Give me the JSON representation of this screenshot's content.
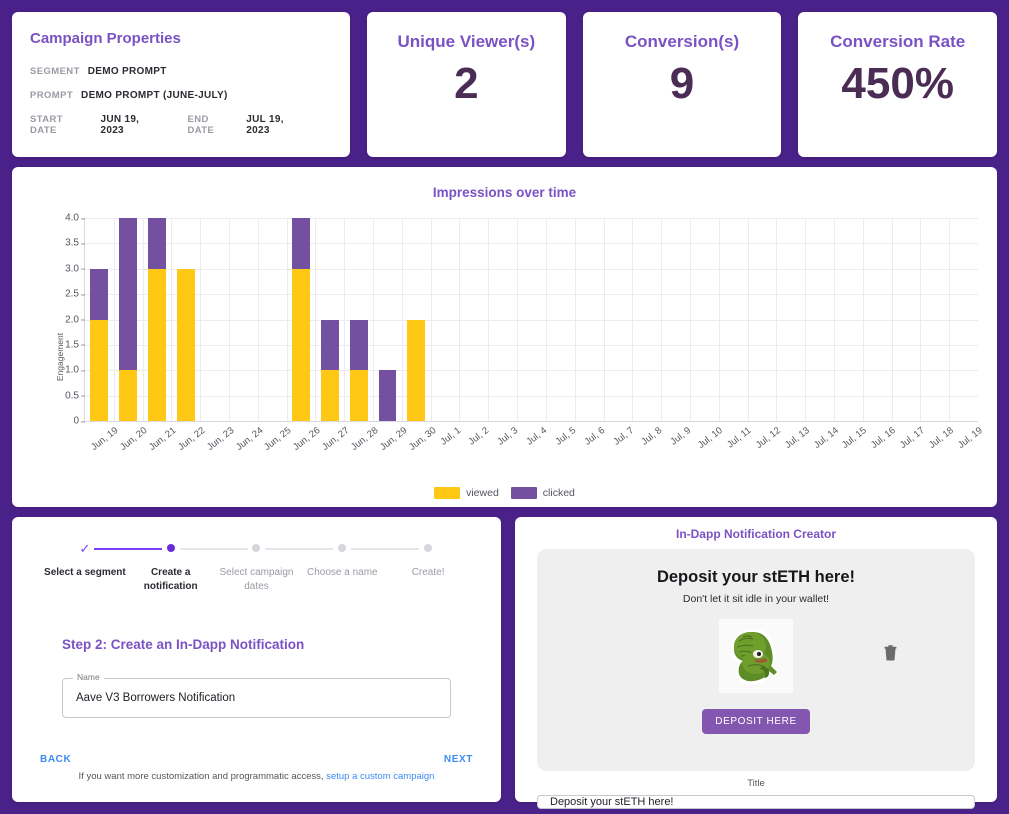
{
  "campaign": {
    "title": "Campaign Properties",
    "rows": [
      {
        "label": "SEGMENT",
        "value": "DEMO PROMPT"
      },
      {
        "label": "PROMPT",
        "value": "DEMO PROMPT (JUNE-JULY)"
      }
    ],
    "start_label": "START DATE",
    "start_value": "JUN 19, 2023",
    "end_label": "END DATE",
    "end_value": "JUL 19, 2023"
  },
  "stats": [
    {
      "label": "Unique Viewer(s)",
      "value": "2"
    },
    {
      "label": "Conversion(s)",
      "value": "9"
    },
    {
      "label": "Conversion Rate",
      "value": "450%"
    }
  ],
  "chart_data": {
    "type": "bar",
    "title": "Impressions over time",
    "xlabel": "",
    "ylabel": "Engagement",
    "ylim": [
      0,
      4.0
    ],
    "yticks": [
      0,
      0.5,
      1.0,
      1.5,
      2.0,
      2.5,
      3.0,
      3.5,
      4.0
    ],
    "ytick_labels": [
      "0",
      "0.5",
      "1.0",
      "1.5",
      "2.0",
      "2.5",
      "3.0",
      "3.5",
      "4.0"
    ],
    "stacked": true,
    "grid": true,
    "legend_position": "bottom",
    "categories": [
      "Jun, 19",
      "Jun, 20",
      "Jun, 21",
      "Jun, 22",
      "Jun, 23",
      "Jun, 24",
      "Jun, 25",
      "Jun, 26",
      "Jun, 27",
      "Jun, 28",
      "Jun, 29",
      "Jun, 30",
      "Jul, 1",
      "Jul, 2",
      "Jul, 3",
      "Jul, 4",
      "Jul, 5",
      "Jul, 6",
      "Jul, 7",
      "Jul, 8",
      "Jul, 9",
      "Jul, 10",
      "Jul, 11",
      "Jul, 12",
      "Jul, 13",
      "Jul, 14",
      "Jul, 15",
      "Jul, 16",
      "Jul, 17",
      "Jul, 18",
      "Jul, 19"
    ],
    "series": [
      {
        "name": "viewed",
        "color": "#FFC814",
        "values": [
          2,
          1,
          3,
          3,
          0,
          0,
          0,
          3,
          1,
          1,
          0,
          2,
          0,
          0,
          0,
          0,
          0,
          0,
          0,
          0,
          0,
          0,
          0,
          0,
          0,
          0,
          0,
          0,
          0,
          0,
          0
        ]
      },
      {
        "name": "clicked",
        "color": "#7350A0",
        "values": [
          1,
          3,
          1,
          0,
          0,
          0,
          0,
          1,
          1,
          1,
          1,
          0,
          0,
          0,
          0,
          0,
          0,
          0,
          0,
          0,
          0,
          0,
          0,
          0,
          0,
          0,
          0,
          0,
          0,
          0,
          0
        ]
      }
    ]
  },
  "wizard": {
    "steps": [
      {
        "label": "Select a segment",
        "state": "done"
      },
      {
        "label": "Create a notification",
        "state": "active"
      },
      {
        "label": "Select campaign dates",
        "state": "todo"
      },
      {
        "label": "Choose a name",
        "state": "todo"
      },
      {
        "label": "Create!",
        "state": "todo"
      }
    ],
    "heading": "Step 2: Create an In-Dapp Notification",
    "field_legend": "Name",
    "field_value": "Aave V3 Borrowers Notification",
    "back_label": "BACK",
    "next_label": "NEXT",
    "footnote_text": "If you want more customization and programmatic access, ",
    "footnote_link": "setup a custom campaign"
  },
  "creator": {
    "title": "In-Dapp Notification Creator",
    "preview_heading": "Deposit your stETH here!",
    "preview_sub": "Don't let it sit idle in your wallet!",
    "cta_label": "DEPOSIT HERE",
    "trash_icon": "trash-icon",
    "title_field_label": "Title",
    "title_field_value": "Deposit your stETH here!"
  },
  "colors": {
    "frame": "#4A2188",
    "accent_purple": "#7B52C4",
    "bar_viewed": "#FFC814",
    "bar_clicked": "#7350A0",
    "link_blue": "#3D8BF2",
    "stat_value": "#4B2C55"
  }
}
